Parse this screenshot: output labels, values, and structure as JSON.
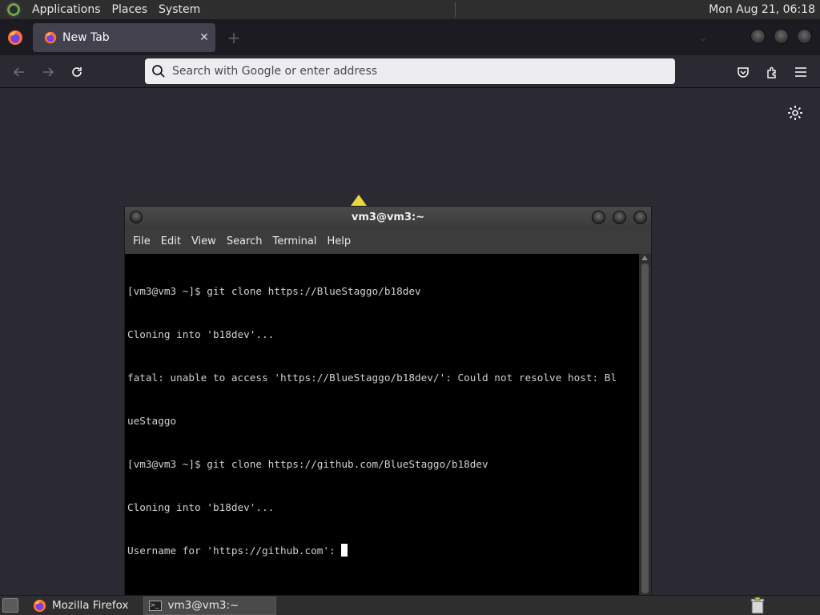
{
  "top_panel": {
    "menus": [
      "Applications",
      "Places",
      "System"
    ],
    "clock": "Mon Aug 21, 06:18"
  },
  "browser": {
    "tab_title": "New Tab",
    "tab_close": "✕",
    "new_tab": "+",
    "urlbar_placeholder": "Search with Google or enter address",
    "nav_icons": [
      "back-icon",
      "forward-icon",
      "reload-icon",
      "pocket-icon",
      "extensions-icon",
      "menu-icon",
      "settings-gear-icon"
    ]
  },
  "terminal": {
    "title": "vm3@vm3:~",
    "menu": [
      "File",
      "Edit",
      "View",
      "Search",
      "Terminal",
      "Help"
    ],
    "lines": [
      "[vm3@vm3 ~]$ git clone https://BlueStaggo/b18dev",
      "Cloning into 'b18dev'...",
      "fatal: unable to access 'https://BlueStaggo/b18dev/': Could not resolve host: Bl",
      "ueStaggo",
      "[vm3@vm3 ~]$ git clone https://github.com/BlueStaggo/b18dev",
      "Cloning into 'b18dev'...",
      "Username for 'https://github.com': "
    ]
  },
  "taskbar": {
    "tasks": [
      "Mozilla Firefox",
      "vm3@vm3:~"
    ]
  },
  "colors": {
    "browser_bg": "#2b2a33",
    "tab_active": "#42414d",
    "terminal_bg": "#000000",
    "terminal_fg": "#d0d0d0",
    "panel_bg": "#2e2e2e"
  }
}
